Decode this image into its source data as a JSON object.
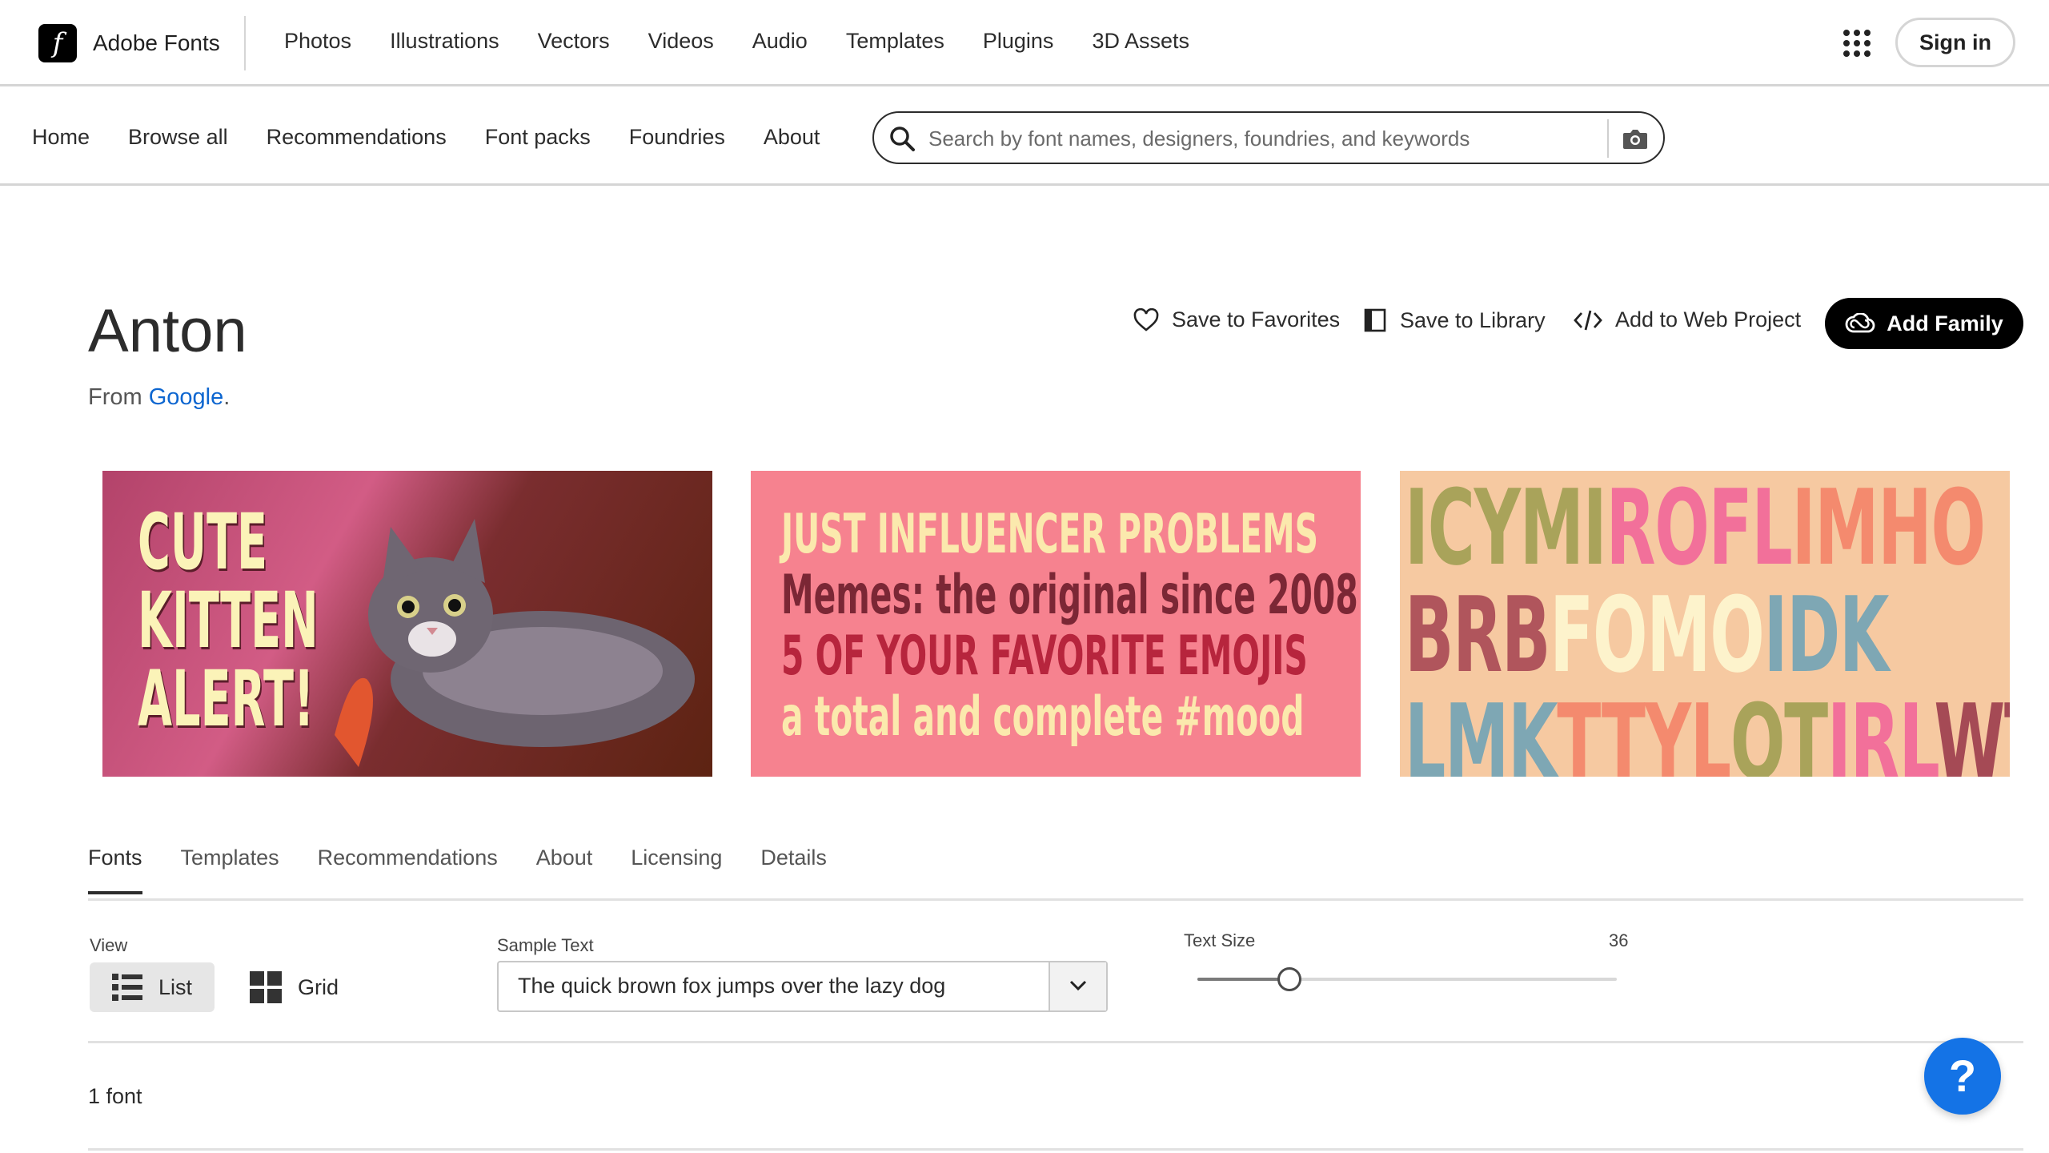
{
  "brand": {
    "name": "Adobe Fonts",
    "logo_letter": "f"
  },
  "topnav": [
    "Photos",
    "Illustrations",
    "Vectors",
    "Videos",
    "Audio",
    "Templates",
    "Plugins",
    "3D Assets"
  ],
  "signin": "Sign in",
  "subnav": [
    "Home",
    "Browse all",
    "Recommendations",
    "Font packs",
    "Foundries",
    "About"
  ],
  "search": {
    "placeholder": "Search by font names, designers, foundries, and keywords"
  },
  "font": {
    "name": "Anton",
    "from_prefix": "From ",
    "foundry": "Google",
    "from_suffix": "."
  },
  "actions": {
    "favorites": "Save to Favorites",
    "library": "Save to Library",
    "web_project": "Add to Web Project",
    "add_family": "Add Family"
  },
  "specimens": {
    "s1": [
      "CUTE",
      "KITTEN",
      "ALERT!"
    ],
    "s2": [
      "JUST INFLUENCER PROBLEMS",
      "Memes: the original since 2008",
      "5 OF YOUR FAVORITE EMOJIS",
      "a total and complete #mood"
    ],
    "s3": [
      [
        {
          "t": "ICYMI",
          "c": "#a9a35a"
        },
        {
          "t": "ROFL",
          "c": "#f2709a"
        },
        {
          "t": "IMHO",
          "c": "#f48a6e"
        }
      ],
      [
        {
          "t": "BRB",
          "c": "#b0555c"
        },
        {
          "t": "FOMO",
          "c": "#fdf3cc"
        },
        {
          "t": "IDK",
          "c": "#7ea7b4"
        }
      ],
      [
        {
          "t": "LMK",
          "c": "#7ea7b4"
        },
        {
          "t": "TTYL",
          "c": "#f48a6e"
        },
        {
          "t": "QT",
          "c": "#a9a35a"
        },
        {
          "t": "IRL",
          "c": "#f2709a"
        },
        {
          "t": "WTH",
          "c": "#a54a55"
        }
      ]
    ]
  },
  "tabs": [
    "Fonts",
    "Templates",
    "Recommendations",
    "About",
    "Licensing",
    "Details"
  ],
  "active_tab": "Fonts",
  "controls": {
    "view_label": "View",
    "view_list": "List",
    "view_grid": "Grid",
    "sample_label": "Sample Text",
    "sample_value": "The quick brown fox jumps over the lazy dog",
    "size_label": "Text Size",
    "size_value": "36",
    "size_fraction": 0.22
  },
  "count": "1 font",
  "help": "?",
  "colors": {
    "accent": "#1473e6",
    "link": "#0d66d0",
    "primary_button": "#000000"
  }
}
